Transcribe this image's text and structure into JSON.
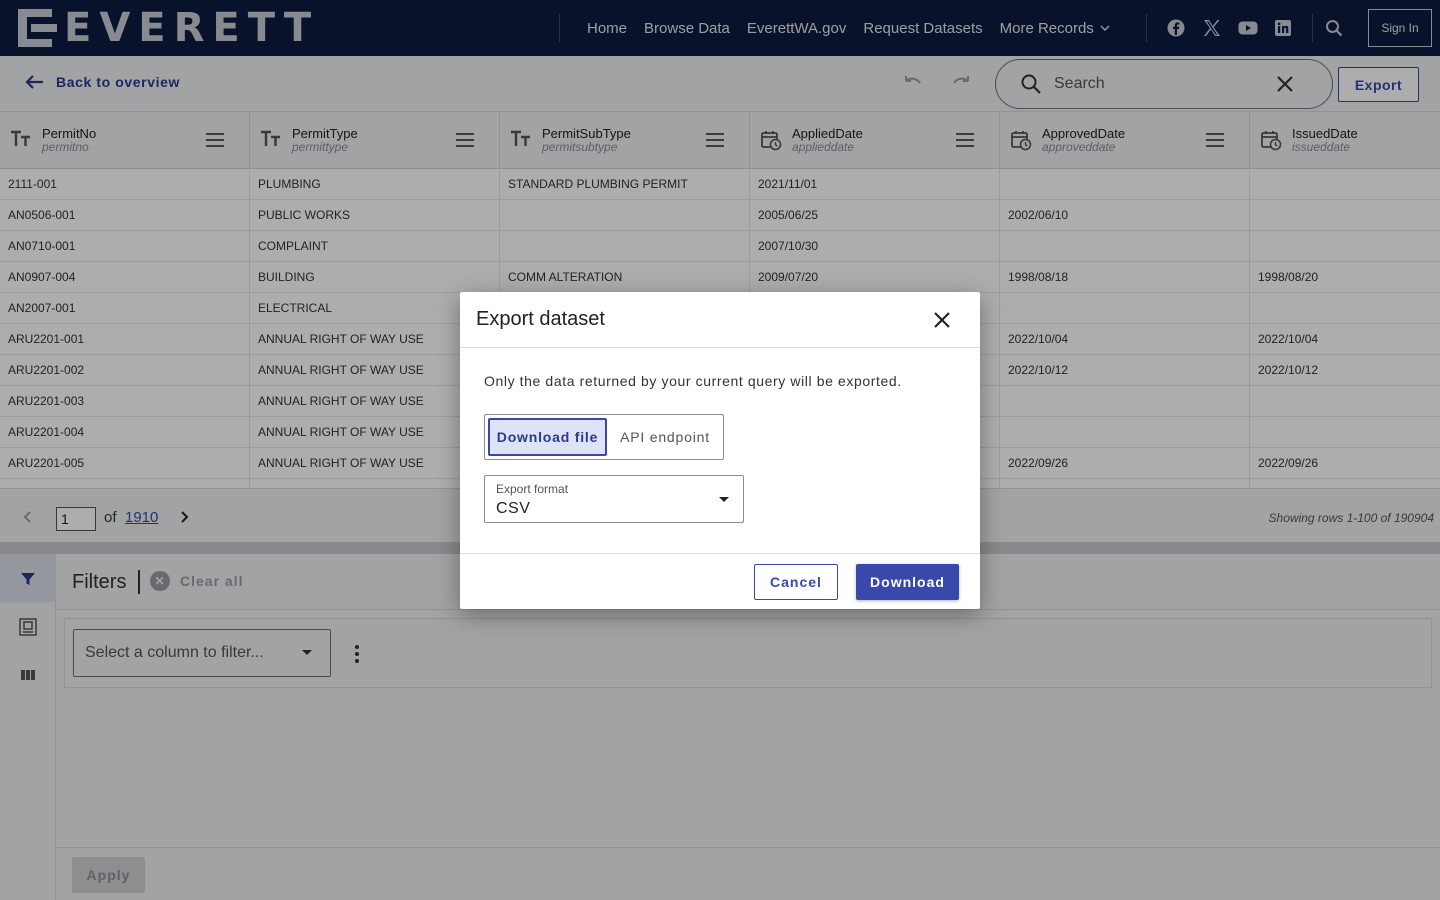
{
  "brand": {
    "name": "EVERETT"
  },
  "nav": {
    "links": [
      "Home",
      "Browse Data",
      "EverettWA.gov",
      "Request Datasets",
      "More Records"
    ],
    "social_icons": [
      "facebook-icon",
      "x-icon",
      "youtube-icon",
      "linkedin-icon"
    ],
    "sign_in": "Sign In"
  },
  "toolbar": {
    "back_label": "Back to overview",
    "search_placeholder": "Search",
    "export_label": "Export"
  },
  "table": {
    "columns": [
      {
        "title": "PermitNo",
        "field": "permitno",
        "type": "text"
      },
      {
        "title": "PermitType",
        "field": "permittype",
        "type": "text"
      },
      {
        "title": "PermitSubType",
        "field": "permitsubtype",
        "type": "text"
      },
      {
        "title": "AppliedDate",
        "field": "applieddate",
        "type": "date"
      },
      {
        "title": "ApprovedDate",
        "field": "approveddate",
        "type": "date"
      },
      {
        "title": "IssuedDate",
        "field": "issueddate",
        "type": "date"
      }
    ],
    "rows": [
      [
        "2111-001",
        "PLUMBING",
        "STANDARD PLUMBING PERMIT",
        "2021/11/01",
        "",
        ""
      ],
      [
        "AN0506-001",
        "PUBLIC WORKS",
        "",
        "2005/06/25",
        "2002/06/10",
        ""
      ],
      [
        "AN0710-001",
        "COMPLAINT",
        "",
        "2007/10/30",
        "",
        ""
      ],
      [
        "AN0907-004",
        "BUILDING",
        "COMM ALTERATION",
        "2009/07/20",
        "1998/08/18",
        "1998/08/20"
      ],
      [
        "AN2007-001",
        "ELECTRICAL",
        "",
        "",
        "",
        ""
      ],
      [
        "ARU2201-001",
        "ANNUAL RIGHT OF WAY USE",
        "",
        "",
        "2022/10/04",
        "2022/10/04"
      ],
      [
        "ARU2201-002",
        "ANNUAL RIGHT OF WAY USE",
        "",
        "",
        "2022/10/12",
        "2022/10/12"
      ],
      [
        "ARU2201-003",
        "ANNUAL RIGHT OF WAY USE",
        "",
        "",
        "",
        ""
      ],
      [
        "ARU2201-004",
        "ANNUAL RIGHT OF WAY USE",
        "",
        "",
        "",
        ""
      ],
      [
        "ARU2201-005",
        "ANNUAL RIGHT OF WAY USE",
        "",
        "",
        "2022/09/26",
        "2022/09/26"
      ]
    ]
  },
  "pager": {
    "current_page": "1",
    "of_label": "of",
    "total_pages": "1910",
    "showing": "Showing rows 1-100 of 190904"
  },
  "filters": {
    "title": "Filters",
    "clear_all": "Clear all",
    "select_placeholder": "Select a column to filter...",
    "apply_label": "Apply"
  },
  "modal": {
    "title": "Export dataset",
    "description": "Only the data returned by your current query will be exported.",
    "tabs": [
      "Download file",
      "API endpoint"
    ],
    "format_label": "Export format",
    "format_value": "CSV",
    "cancel_label": "Cancel",
    "download_label": "Download"
  },
  "colors": {
    "nav_bg": "#0d1b3e",
    "accent": "#3949ab",
    "panel_bg": "#eef0f3"
  }
}
